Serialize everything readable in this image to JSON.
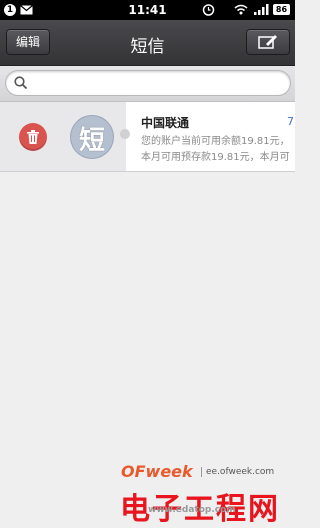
{
  "status_bar": {
    "notification_count": "1",
    "time": "11:41",
    "battery": "86"
  },
  "header": {
    "edit_label": "编辑",
    "title": "短信"
  },
  "search": {
    "placeholder": ""
  },
  "messages": [
    {
      "avatar_glyph": "短",
      "sender": "中国联通",
      "date": "7",
      "preview_line1": "您的账户当前可用余额19.81元，",
      "preview_line2": "本月可用预存款19.81元，本月可"
    }
  ],
  "watermark": {
    "logo": "OFweek",
    "url": "ee.ofweek.com",
    "cn": "电子工程网",
    "site": "www.edatop.com"
  },
  "colors": {
    "delete": "#d9534f",
    "date_accent": "#3b74c9",
    "watermark_red": "#e8141e"
  }
}
